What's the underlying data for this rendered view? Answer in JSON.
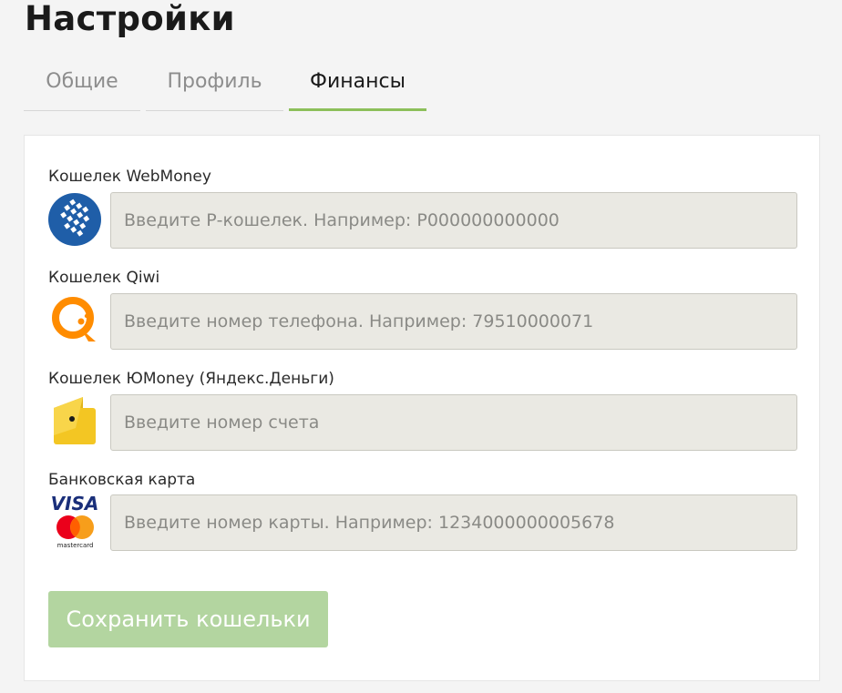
{
  "page": {
    "title": "Настройки"
  },
  "tabs": [
    {
      "label": "Общие",
      "active": false
    },
    {
      "label": "Профиль",
      "active": false
    },
    {
      "label": "Финансы",
      "active": true
    }
  ],
  "accent_color": "#8cbf5a",
  "wallets": [
    {
      "label": "Кошелек WebMoney",
      "icon": "webmoney-icon",
      "value": "",
      "placeholder": "Введите Р-кошелек. Например: Р000000000000"
    },
    {
      "label": "Кошелек Qiwi",
      "icon": "qiwi-icon",
      "value": "",
      "placeholder": "Введите номер телефона. Например: 79510000071"
    },
    {
      "label": "Кошелек ЮMoney (Яндекс.Деньги)",
      "icon": "yoomoney-icon",
      "value": "",
      "placeholder": "Введите номер счета"
    },
    {
      "label": "Банковская карта",
      "icon": "visa-mastercard-icon",
      "value": "",
      "placeholder": "Введите номер карты. Например: 1234000000005678"
    }
  ],
  "card_logos": {
    "visa": "VISA",
    "mastercard": "mastercard"
  },
  "save_button": {
    "label": "Сохранить кошельки",
    "color": "#b3d5a0"
  }
}
